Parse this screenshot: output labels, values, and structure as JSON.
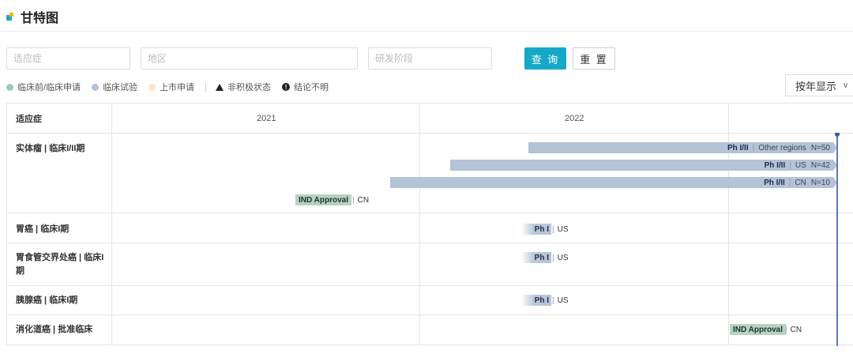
{
  "title": "甘特图",
  "filters": {
    "indication_placeholder": "适应症",
    "region_placeholder": "地区",
    "stage_placeholder": "研发阶段"
  },
  "buttons": {
    "query": "查 询",
    "reset": "重 置"
  },
  "legend": {
    "preclinical": "临床前/临床申请",
    "clinical": "临床试验",
    "market": "上市申请",
    "inactive": "非积极状态",
    "unknown": "结论不明"
  },
  "colors": {
    "preclinical": "#9ec9b0",
    "clinical": "#b4c3d6",
    "market": "#fde3c8",
    "accent": "#16a8c7"
  },
  "view_select": {
    "selected": "按年显示"
  },
  "table": {
    "col_indication": "适应症",
    "years": [
      "2021",
      "2022"
    ],
    "rows": [
      {
        "label": "实体瘤 | 临床I/II期",
        "bars": [
          {
            "phase": "Ph I/II",
            "region": "Other regions",
            "n": "N=50"
          },
          {
            "phase": "Ph I/II",
            "region": "US",
            "n": "N=42"
          },
          {
            "phase": "Ph I/II",
            "region": "CN",
            "n": "N=10"
          },
          {
            "phase": "IND Approval",
            "region": "CN"
          }
        ]
      },
      {
        "label": "胃癌 | 临床I期",
        "bars": [
          {
            "phase": "Ph I",
            "region": "US"
          }
        ]
      },
      {
        "label": "胃食管交界处癌 | 临床I期",
        "bars": [
          {
            "phase": "Ph I",
            "region": "US"
          }
        ]
      },
      {
        "label": "胰腺癌 | 临床I期",
        "bars": [
          {
            "phase": "Ph I",
            "region": "US"
          }
        ]
      },
      {
        "label": "消化道癌 | 批准临床",
        "bars": [
          {
            "phase": "IND Approval",
            "region": "CN"
          }
        ]
      }
    ]
  }
}
